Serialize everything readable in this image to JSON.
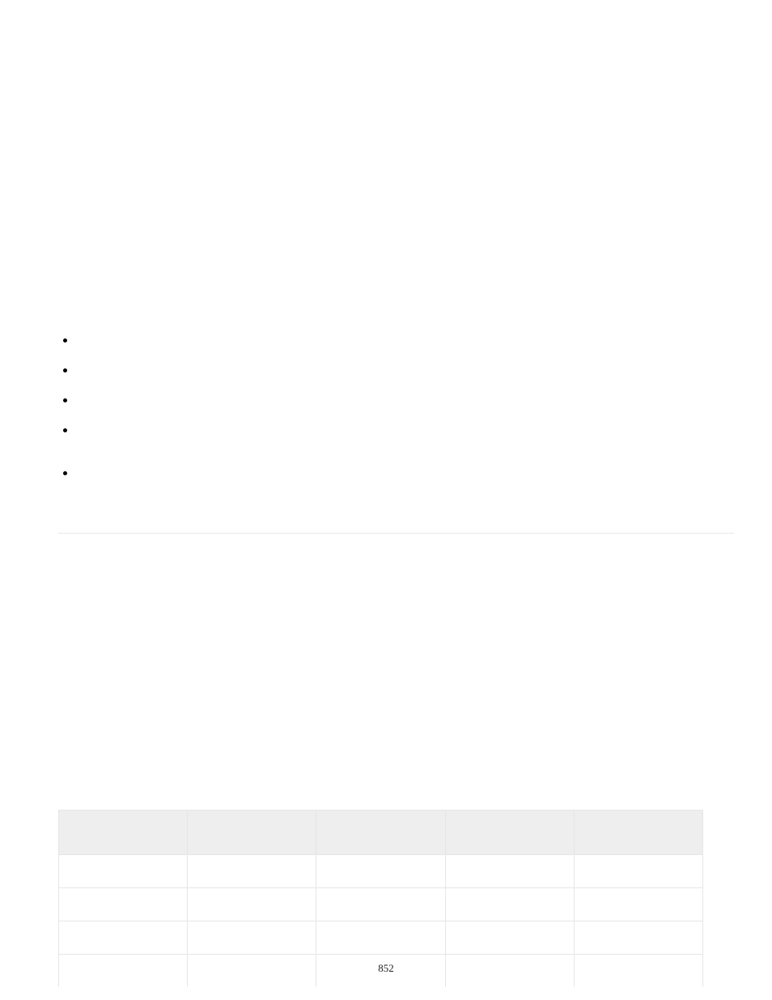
{
  "bullets": [
    "",
    "",
    "",
    "",
    ""
  ],
  "table": {
    "headers": [
      "",
      "",
      "",
      "",
      ""
    ],
    "rows": [
      [
        "",
        "",
        "",
        "",
        ""
      ],
      [
        "",
        "",
        "",
        "",
        ""
      ],
      [
        "",
        "",
        "",
        "",
        ""
      ],
      [
        "",
        "",
        "",
        "",
        ""
      ]
    ]
  },
  "pageNumber": "852"
}
